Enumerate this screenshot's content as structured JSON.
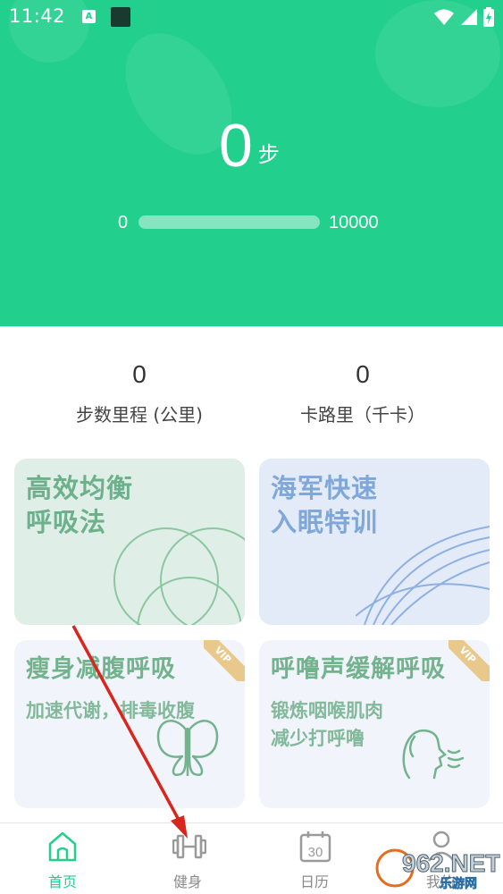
{
  "status_bar": {
    "time": "11:42",
    "a_badge": "A"
  },
  "steps": {
    "value": "0",
    "unit": "步",
    "progress_min": "0",
    "progress_max": "10000",
    "progress_fraction": 0
  },
  "stats": [
    {
      "value": "0",
      "label": "步数里程 (公里)"
    },
    {
      "value": "0",
      "label": "卡路里（千卡）"
    }
  ],
  "cards": [
    {
      "title_line1": "高效均衡",
      "title_line2": "呼吸法"
    },
    {
      "title_line1": "海军快速",
      "title_line2": "入眠特训"
    },
    {
      "title": "瘦身减腹呼吸",
      "subtitle_line1": "加速代谢，排毒收腹",
      "badge": "VIP"
    },
    {
      "title": "呼噜声缓解呼吸",
      "subtitle_line1": "锻炼咽喉肌肉",
      "subtitle_line2": "减少打呼噜",
      "badge": "VIP"
    }
  ],
  "nav": [
    {
      "label": "首页",
      "icon": "home-icon",
      "active": true
    },
    {
      "label": "健身",
      "icon": "dumbbell-icon"
    },
    {
      "label": "日历",
      "icon": "calendar-icon",
      "calendar_day": "30"
    },
    {
      "label": "我的",
      "icon": "user-icon"
    }
  ],
  "watermark": {
    "text": "962.NET",
    "subtext": "乐游网"
  },
  "colors": {
    "primary": "#22cf8d",
    "card_green": "#dfeee6",
    "card_blue": "#e2ebf7",
    "vip": "#e9c98b"
  }
}
